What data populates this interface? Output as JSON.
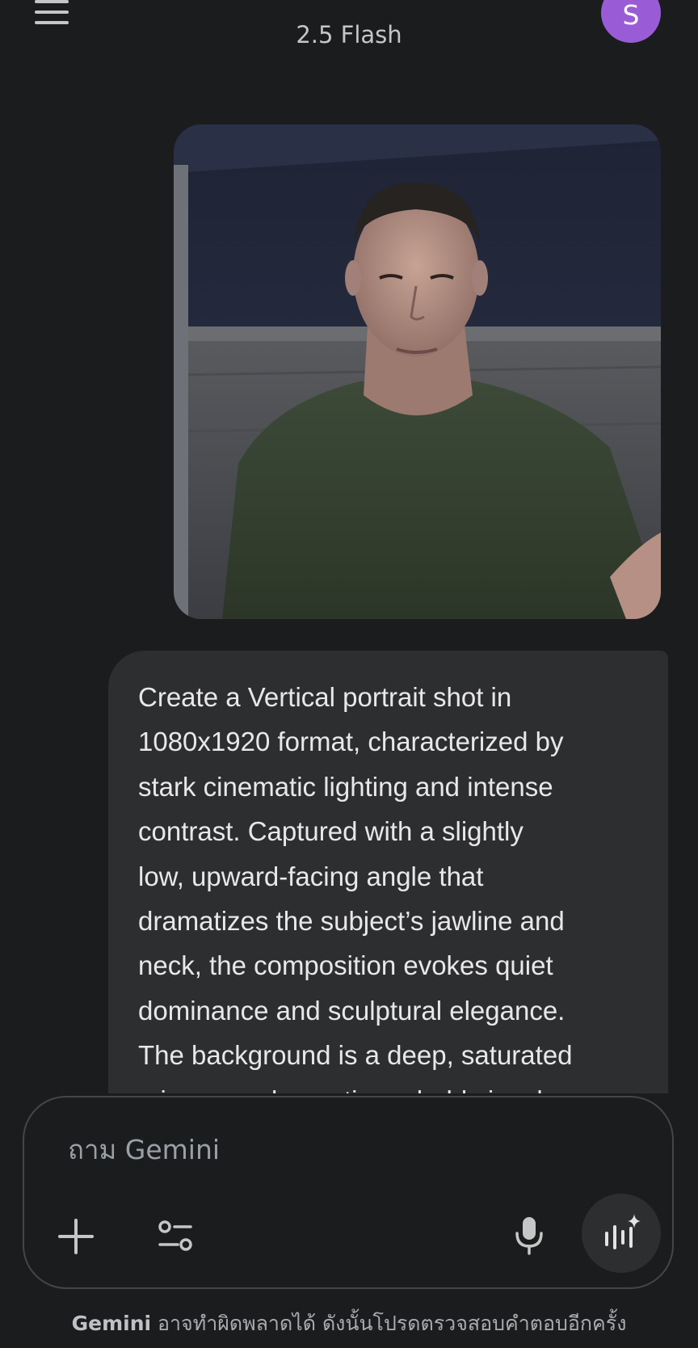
{
  "header": {
    "model_label": "2.5 Flash",
    "avatar_initial": "S"
  },
  "message": {
    "text": "Create a Vertical portrait shot in\n1080x1920 format, characterized by\nstark cinematic lighting and intense\ncontrast. Captured with a slightly\nlow, upward-facing angle that\ndramatizes the subject’s jawline and\nneck, the composition evokes quiet\ndominance and sculptural elegance.\nThe background is a deep, saturated\ncrimson red, creating a bold visual"
  },
  "input": {
    "placeholder": "ถาม Gemini"
  },
  "icons": {
    "menu": "hamburger-menu-icon",
    "add": "plus-icon",
    "tools": "tools-sliders-icon",
    "mic": "microphone-icon",
    "live": "gemini-live-icon"
  },
  "footer": {
    "brand": "Gemini",
    "disclaimer": " อาจทำผิดพลาดได้ ดังนั้นโปรดตรวจสอบคำตอบอีกครั้ง"
  },
  "colors": {
    "background": "#1b1c1e",
    "bubble": "#2d2e30",
    "avatar": "#9a5cd6"
  }
}
